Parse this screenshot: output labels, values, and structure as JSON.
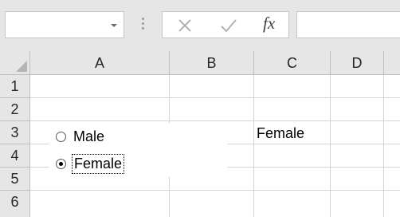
{
  "formula_bar": {
    "name_box_value": "",
    "cancel_icon": "cancel-x-icon",
    "enter_icon": "enter-check-icon",
    "function_label": "fx",
    "formula_value": ""
  },
  "columns": [
    {
      "label": "A"
    },
    {
      "label": "B"
    },
    {
      "label": "C"
    },
    {
      "label": "D"
    }
  ],
  "rows": [
    {
      "label": "1"
    },
    {
      "label": "2"
    },
    {
      "label": "3"
    },
    {
      "label": "4"
    },
    {
      "label": "5"
    },
    {
      "label": "6"
    }
  ],
  "cells": {
    "C3": "Female"
  },
  "option_buttons": [
    {
      "label": "Male",
      "selected": false
    },
    {
      "label": "Female",
      "selected": true
    }
  ]
}
